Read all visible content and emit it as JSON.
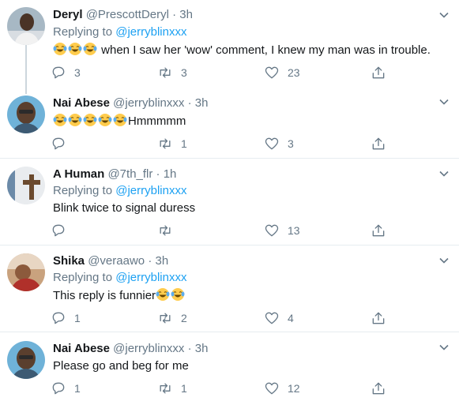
{
  "tweets": [
    {
      "name": "Deryl",
      "handle": "@PrescottDeryl",
      "dot": "·",
      "time": "3h",
      "replying_prefix": "Replying to",
      "replying_to": "@jerryblinxxx",
      "emoji_count": 3,
      "text": " when I saw her 'wow' comment, I knew my man was in trouble.",
      "reply_count": "3",
      "retweet_count": "3",
      "like_count": "23",
      "avatar_icon": "person-photo-avatar"
    },
    {
      "name": "Nai Abese",
      "handle": "@jerryblinxxx",
      "dot": "·",
      "time": "3h",
      "emoji_count": 5,
      "text": "Hmmmmm",
      "reply_count": "",
      "retweet_count": "1",
      "like_count": "3",
      "avatar_icon": "person-photo-avatar"
    },
    {
      "name": "A Human",
      "handle": "@7th_flr",
      "dot": "·",
      "time": "1h",
      "replying_prefix": "Replying to",
      "replying_to": "@jerryblinxxx",
      "emoji_count": 0,
      "text": "Blink twice to signal duress",
      "reply_count": "",
      "retweet_count": "",
      "like_count": "13",
      "avatar_icon": "cross-photo-avatar"
    },
    {
      "name": "Shika",
      "handle": "@veraawo",
      "dot": "·",
      "time": "3h",
      "replying_prefix": "Replying to",
      "replying_to": "@jerryblinxxx",
      "emoji_count": 0,
      "text": "This reply is funnier",
      "trailing_emoji_count": 2,
      "reply_count": "1",
      "retweet_count": "2",
      "like_count": "4",
      "avatar_icon": "photo-avatar"
    },
    {
      "name": "Nai Abese",
      "handle": "@jerryblinxxx",
      "dot": "·",
      "time": "3h",
      "emoji_count": 0,
      "text": "Please go and beg for me",
      "reply_count": "1",
      "retweet_count": "1",
      "like_count": "12",
      "avatar_icon": "person-photo-avatar"
    }
  ],
  "icons": {
    "reply": "reply-icon",
    "retweet": "retweet-icon",
    "like": "heart-icon",
    "share": "share-icon",
    "more": "chevron-down-icon",
    "emoji": "face-with-tears-of-joy-emoji"
  },
  "colors": {
    "link": "#1da1f2",
    "secondary_text": "#657786",
    "divider": "#e6ecf0",
    "thread_line": "#ccd6dd",
    "emoji_face": "#ffcc4d",
    "emoji_tear": "#5dadec"
  }
}
